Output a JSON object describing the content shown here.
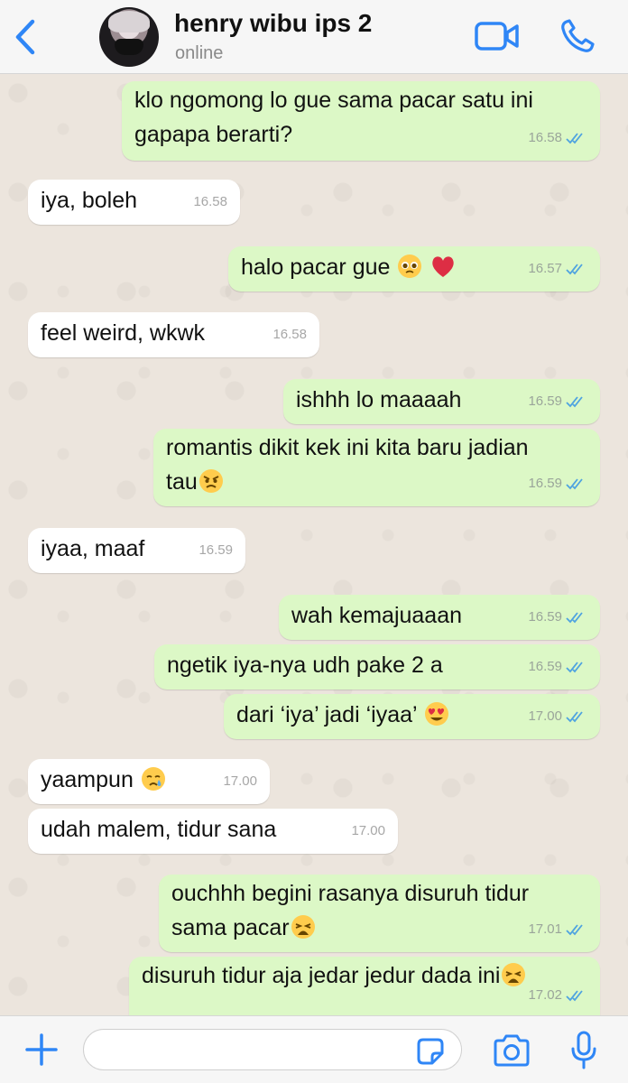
{
  "header": {
    "contact_name": "henry wibu ips 2",
    "status": "online",
    "icons": {
      "back": "chevron-left-icon",
      "video": "video-camera-icon",
      "call": "phone-icon"
    },
    "accent_color": "#2f86f6"
  },
  "messages": [
    {
      "dir": "out",
      "lines": [
        "klo ngomong lo gue sama pacar satu ini",
        "gapapa berarti?"
      ],
      "time": "16.58",
      "read": true
    },
    {
      "dir": "in",
      "lines": [
        "iya, boleh"
      ],
      "time": "16.58"
    },
    {
      "dir": "out",
      "lines": [
        "halo pacar gue"
      ],
      "emojis": [
        "pleading-face",
        "red-heart"
      ],
      "time": "16.57",
      "read": true
    },
    {
      "dir": "in",
      "lines": [
        "feel weird, wkwk"
      ],
      "time": "16.58"
    },
    {
      "dir": "out",
      "lines": [
        "ishhh lo maaaah"
      ],
      "time": "16.59",
      "read": true
    },
    {
      "dir": "out",
      "lines": [
        "romantis dikit kek ini kita baru jadian",
        "tau"
      ],
      "emojis": [
        "angry-face"
      ],
      "time": "16.59",
      "read": true
    },
    {
      "dir": "in",
      "lines": [
        "iyaa, maaf"
      ],
      "time": "16.59"
    },
    {
      "dir": "out",
      "lines": [
        "wah kemajuaaan"
      ],
      "time": "16.59",
      "read": true
    },
    {
      "dir": "out",
      "lines": [
        "ngetik iya-nya udh pake 2 a"
      ],
      "time": "16.59",
      "read": true
    },
    {
      "dir": "out",
      "lines": [
        "dari ‘iya’ jadi ‘iyaa’"
      ],
      "emojis": [
        "heart-eyes-face"
      ],
      "time": "17.00",
      "read": true
    },
    {
      "dir": "in",
      "lines": [
        "yaampun"
      ],
      "emojis": [
        "crying-face"
      ],
      "time": "17.00"
    },
    {
      "dir": "in",
      "lines": [
        "udah malem, tidur sana"
      ],
      "time": "17.00"
    },
    {
      "dir": "out",
      "lines": [
        "ouchhh begini rasanya disuruh tidur",
        "sama pacar"
      ],
      "emojis": [
        "weary-face"
      ],
      "time": "17.01",
      "read": true
    },
    {
      "dir": "out",
      "lines": [
        "disuruh tidur aja jedar jedur dada ini"
      ],
      "emojis": [
        "weary-face"
      ],
      "time": "17.02",
      "read": true
    }
  ],
  "composer": {
    "placeholder": "",
    "icons": {
      "plus": "plus-icon",
      "sticker": "sticker-icon",
      "camera": "camera-icon",
      "mic": "microphone-icon"
    }
  },
  "colors": {
    "outgoing_bubble": "#dcf8c6",
    "incoming_bubble": "#ffffff",
    "read_ticks": "#4fa3e0",
    "chat_background": "#ece5dd"
  }
}
